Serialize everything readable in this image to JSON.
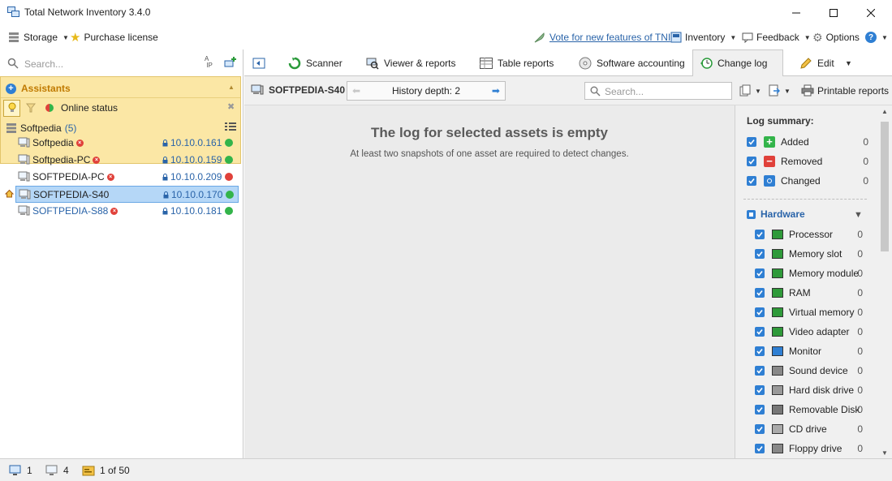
{
  "window": {
    "title": "Total Network Inventory 3.4.0"
  },
  "menu": {
    "storage": "Storage",
    "purchase": "Purchase license",
    "vote": "Vote for new features of TNI",
    "inventory": "Inventory",
    "feedback": "Feedback",
    "options": "Options"
  },
  "left": {
    "search_placeholder": "Search...",
    "assistants_title": "Assistants",
    "online_status": "Online status",
    "group": {
      "name": "Softpedia",
      "count": "(5)"
    },
    "assets": [
      {
        "name": "Softpedia",
        "ip": "10.10.0.161",
        "status": "#33b44a",
        "error": true
      },
      {
        "name": "Softpedia-PC",
        "ip": "10.10.0.159",
        "status": "#33b44a",
        "error": true
      },
      {
        "name": "SOFTPEDIA-PC",
        "ip": "10.10.0.209",
        "status": "#e0413a",
        "error": true
      },
      {
        "name": "SOFTPEDIA-S40",
        "ip": "10.10.0.170",
        "status": "#33b44a",
        "error": false
      },
      {
        "name": "SOFTPEDIA-S88",
        "ip": "10.10.0.181",
        "status": "#33b44a",
        "error": true
      }
    ]
  },
  "tabs": {
    "scanner": "Scanner",
    "viewer": "Viewer & reports",
    "table": "Table reports",
    "software": "Software accounting",
    "changelog": "Change log",
    "edit": "Edit"
  },
  "subbar": {
    "asset": "SOFTPEDIA-S40",
    "history": "History depth: 2",
    "search_placeholder": "Search...",
    "printable": "Printable reports"
  },
  "main": {
    "empty_title": "The log for selected assets is empty",
    "empty_sub": "At least two snapshots of one asset are required to detect changes."
  },
  "summary": {
    "title": "Log summary:",
    "added": "Added",
    "removed": "Removed",
    "changed": "Changed",
    "hardware": "Hardware",
    "items": [
      {
        "label": "Processor",
        "count": "0"
      },
      {
        "label": "Memory slot",
        "count": "0"
      },
      {
        "label": "Memory module",
        "count": "0"
      },
      {
        "label": "RAM",
        "count": "0"
      },
      {
        "label": "Virtual memory",
        "count": "0"
      },
      {
        "label": "Video adapter",
        "count": "0"
      },
      {
        "label": "Monitor",
        "count": "0"
      },
      {
        "label": "Sound device",
        "count": "0"
      },
      {
        "label": "Hard disk drive",
        "count": "0"
      },
      {
        "label": "Removable Disk",
        "count": "0"
      },
      {
        "label": "CD drive",
        "count": "0"
      },
      {
        "label": "Floppy drive",
        "count": "0"
      }
    ],
    "zero": "0"
  },
  "status": {
    "selected": "1",
    "assets": "4",
    "page": "1 of 50"
  },
  "colors": {
    "accent": "#2f7fd3",
    "link": "#2a64a9",
    "assist_bg": "#fbe7a5",
    "assist_title": "#c07a00"
  }
}
